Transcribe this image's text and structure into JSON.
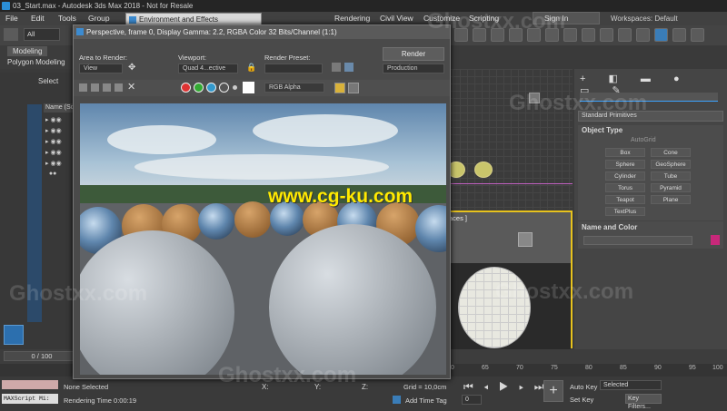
{
  "window": {
    "title": "03_Start.max - Autodesk 3ds Max 2018 - Not for Resale"
  },
  "menu": {
    "items": [
      "File",
      "Edit",
      "Tools",
      "Group"
    ],
    "right_items": [
      "Rendering",
      "Civil View",
      "Customize",
      "Scripting"
    ]
  },
  "signin": {
    "label": "Sign In"
  },
  "workspaces": {
    "label": "Workspaces:",
    "value": "Default"
  },
  "toolbar": {
    "filter_value": "All"
  },
  "ribbon": {
    "tab_modeling": "Modeling",
    "tab_polygon": "Polygon Modeling"
  },
  "scene_explorer": {
    "select_label": "Select",
    "column_name": "Name (So"
  },
  "env_dialog": {
    "title": "Environment and Effects"
  },
  "render_window": {
    "title": "Perspective, frame 0, Display Gamma: 2.2, RGBA Color 32 Bits/Channel (1:1)",
    "area_label": "Area to Render:",
    "area_value": "View",
    "viewport_label": "Viewport:",
    "viewport_value": "Quad 4...ective",
    "preset_label": "Render Preset:",
    "preset_value": "",
    "render_button": "Render",
    "production_value": "Production",
    "channel_value": "RGB Alpha"
  },
  "watermark": {
    "text": "www.cg-ku.com",
    "ghost": "Ghostxx.com"
  },
  "viewport_persp": {
    "label": "aces ]"
  },
  "cmd_panel": {
    "dropdown": "Standard Primitives",
    "object_type": "Object Type",
    "autogrid": "AutoGrid",
    "buttons": [
      "Box",
      "Cone",
      "Sphere",
      "GeoSphere",
      "Cylinder",
      "Tube",
      "Torus",
      "Pyramid",
      "Teapot",
      "Plane",
      "TextPlus"
    ],
    "name_color": "Name and Color"
  },
  "timeline": {
    "frame_label": "0 / 100",
    "ticks": [
      "60",
      "65",
      "70",
      "75",
      "80",
      "85",
      "90",
      "95",
      "100"
    ]
  },
  "status": {
    "selection": "None Selected",
    "render_time": "Rendering Time  0:00:19",
    "maxscript": "MAXScript Mi:",
    "x_label": "X:",
    "y_label": "Y:",
    "z_label": "Z:",
    "grid": "Grid = 10,0cm",
    "add_time_tag": "Add Time Tag",
    "frame_value": "0",
    "auto_key": "Auto Key",
    "selected_value": "Selected",
    "set_key": "Set Key",
    "key_filters": "Key Filters..."
  },
  "colors": {
    "accent_blue": "#2b8fd6",
    "viewport_border": "#e7c21d",
    "watermark": "#ffea00",
    "swatch": "#c8287a"
  }
}
